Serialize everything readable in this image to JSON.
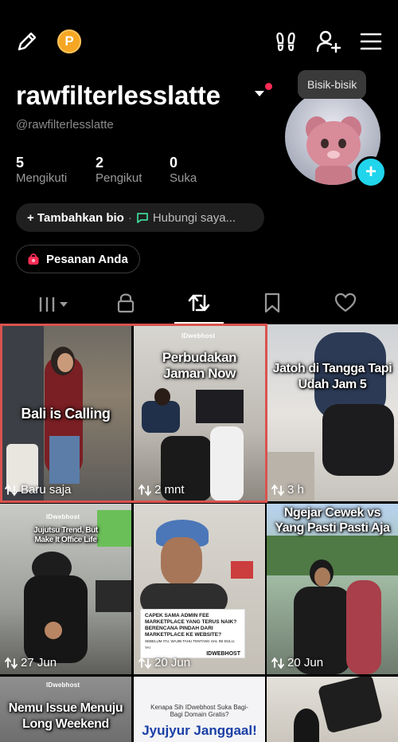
{
  "header": {
    "coin_letter": "P",
    "username": "rawfilterlesslatte",
    "handle": "@rawfilterlesslatte",
    "tooltip": "Bisik-bisik"
  },
  "stats": [
    {
      "value": "5",
      "label": "Mengikuti"
    },
    {
      "value": "2",
      "label": "Pengikut"
    },
    {
      "value": "0",
      "label": "Suka"
    }
  ],
  "actions": {
    "add_bio": "+ Tambahkan bio",
    "separator": "·",
    "contact": "Hubungi saya...",
    "orders": "Pesanan Anda"
  },
  "tabs": [
    {
      "name": "videos",
      "icon": "grid-icon"
    },
    {
      "name": "private",
      "icon": "lock-icon"
    },
    {
      "name": "reposts",
      "icon": "repost-icon",
      "active": true
    },
    {
      "name": "saved",
      "icon": "bookmark-icon"
    },
    {
      "name": "liked",
      "icon": "heart-icon"
    }
  ],
  "grid": [
    {
      "title": "Bali is Calling",
      "time": "Baru saja"
    },
    {
      "title": "Perbudakan Jaman Now",
      "time": "2 mnt",
      "brand": "IDwebhost"
    },
    {
      "title": "Jatoh di Tangga Tapi Udah Jam 5",
      "time": "3 h"
    },
    {
      "title": "Jujutsu Trend, But Make It Office Life",
      "time": "27 Jun",
      "brand": "IDwebhost"
    },
    {
      "title": "",
      "time": "20 Jun",
      "banner_lines": [
        "CAPEK SAMA ADMIN FEE",
        "MARKETPLACE YANG TERUS NAIK?",
        "BERENCANA PINDAH DARI",
        "MARKETPLACE KE WEBSITE?",
        "SEBELUM ITU, WAJIB TAHU TENTANG HAL INI DULU, YA!"
      ],
      "banner_brand": "IDWEBHOST"
    },
    {
      "title": "Ngejar Cewek vs Yang Pasti Pasti Aja",
      "time": "20 Jun"
    },
    {
      "title": "Nemu Issue Menuju Long Weekend",
      "time": "",
      "brand": "IDwebhost"
    },
    {
      "title": "Jyujyur Janggaal!",
      "time": "",
      "subtitle": "Kenapa Sih IDwebhost Suka Bagi-Bagi Domain Gratis?"
    },
    {
      "title": "",
      "time": ""
    }
  ],
  "colors": {
    "accent_red": "#fe2c55",
    "avatar_add": "#20d5ec",
    "coin": "#f5a623",
    "selection": "#d9534f"
  }
}
